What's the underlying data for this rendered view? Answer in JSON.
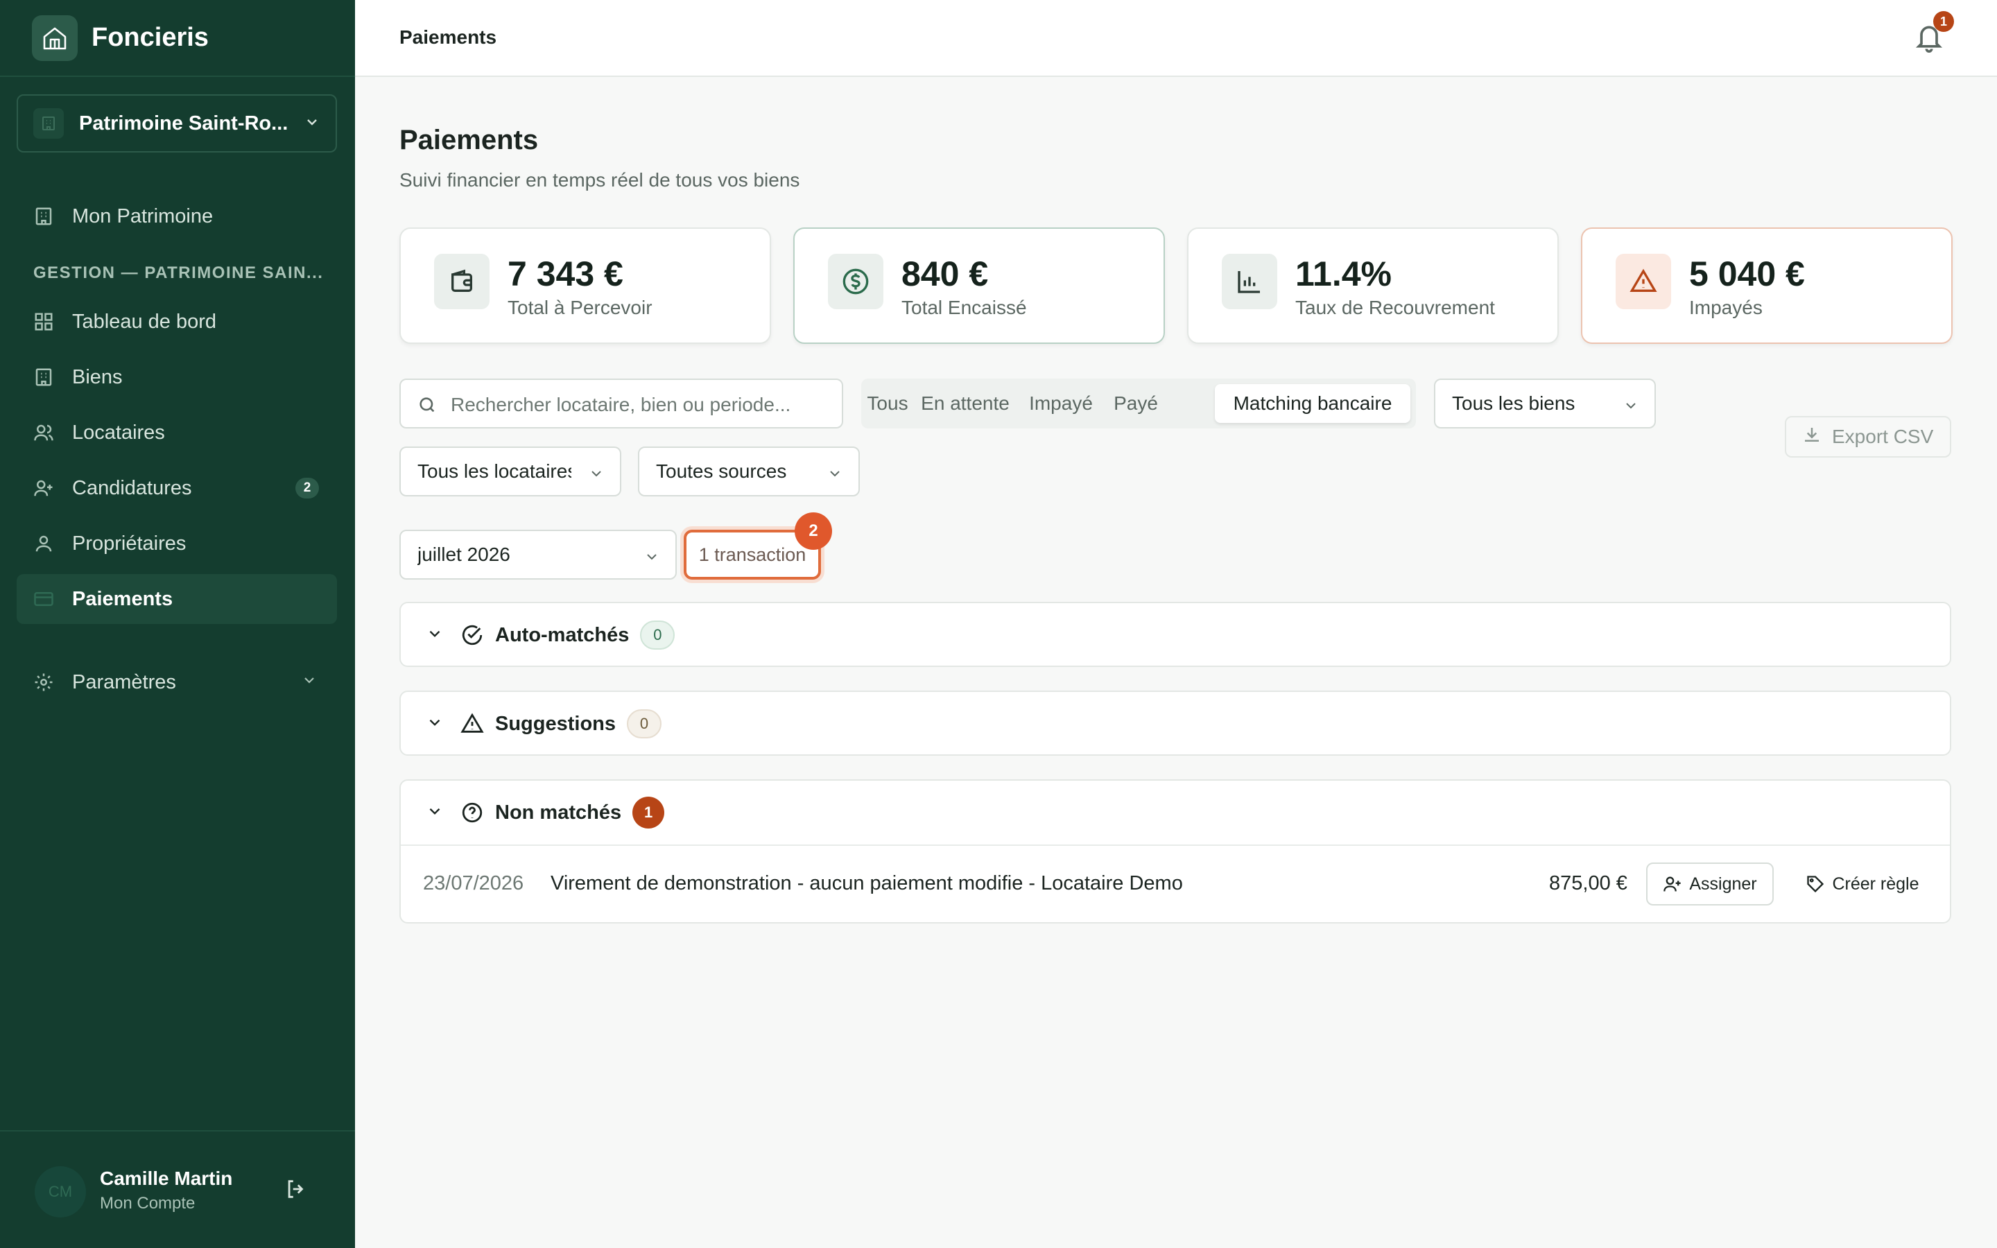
{
  "app": {
    "name": "Foncieris"
  },
  "sidebar": {
    "org_name": "Patrimoine Saint-Ro...",
    "top_item": "Mon Patrimoine",
    "section_label": "GESTION — PATRIMOINE SAIN...",
    "items": [
      {
        "label": "Tableau de bord",
        "icon": "dashboard-icon"
      },
      {
        "label": "Biens",
        "icon": "building-icon"
      },
      {
        "label": "Locataires",
        "icon": "users-icon"
      },
      {
        "label": "Candidatures",
        "icon": "user-plus-icon",
        "badge": "2"
      },
      {
        "label": "Propriétaires",
        "icon": "user-icon"
      },
      {
        "label": "Paiements",
        "icon": "credit-card-icon",
        "active": true
      }
    ],
    "settings_label": "Paramètres",
    "user": {
      "initials": "CM",
      "name": "Camille Martin",
      "subtitle": "Mon Compte"
    }
  },
  "header": {
    "title": "Paiements",
    "notification_count": "1"
  },
  "page": {
    "title": "Paiements",
    "subtitle": "Suivi financier en temps réel de tous vos biens"
  },
  "stats": [
    {
      "value": "7 343 €",
      "label": "Total à Percevoir",
      "icon": "wallet-icon"
    },
    {
      "value": "840 €",
      "label": "Total Encaissé",
      "icon": "dollar-circle-icon"
    },
    {
      "value": "11.4%",
      "label": "Taux de Recouvrement",
      "icon": "bar-chart-icon"
    },
    {
      "value": "5 040 €",
      "label": "Impayés",
      "icon": "warning-icon"
    }
  ],
  "filters": {
    "search_placeholder": "Rechercher locataire, bien ou periode...",
    "tabs": [
      "Tous",
      "En attente",
      "Impayé",
      "Payé",
      "Matching bancaire"
    ],
    "active_tab": "Matching bancaire",
    "property_select": "Tous les biens",
    "tenant_select": "Tous les locataires",
    "source_select": "Toutes sources",
    "month_select": "juillet 2026",
    "transaction_chip": "1 transaction",
    "transaction_badge": "2",
    "export_label": "Export CSV"
  },
  "sections": [
    {
      "title": "Auto-matchés",
      "count": "0",
      "icon": "check-circle-icon"
    },
    {
      "title": "Suggestions",
      "count": "0",
      "icon": "warning-icon"
    },
    {
      "title": "Non matchés",
      "count": "1",
      "icon": "help-circle-icon"
    }
  ],
  "unmatched": [
    {
      "date": "23/07/2026",
      "description": "Virement de demonstration - aucun paiement modifie - Locataire Demo",
      "amount": "875,00 €",
      "assign_label": "Assigner",
      "rule_label": "Créer règle"
    }
  ],
  "colors": {
    "sidebar": "#143d2f",
    "accent": "#e0582c",
    "danger": "#b74516"
  }
}
